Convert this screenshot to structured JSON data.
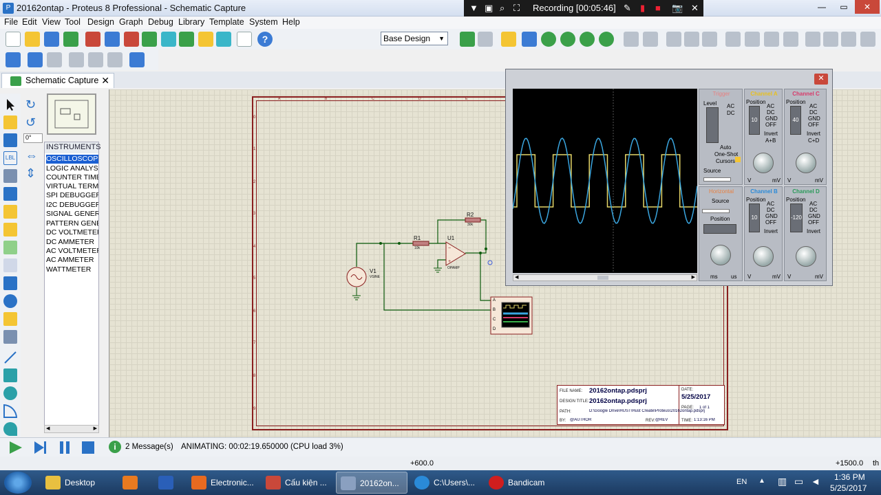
{
  "window": {
    "title": "20162ontap - Proteus 8 Professional - Schematic Capture"
  },
  "recording": {
    "label": "Recording [00:05:46]"
  },
  "menu": [
    "File",
    "Edit",
    "View",
    "Tool",
    "Design",
    "Graph",
    "Debug",
    "Library",
    "Template",
    "System",
    "Help"
  ],
  "toolbar": {
    "design_select": "Base Design"
  },
  "tab": {
    "label": "Schematic Capture"
  },
  "left": {
    "angle": "0°"
  },
  "instruments": {
    "header": "INSTRUMENTS",
    "items": [
      "OSCILLOSCOPE",
      "LOGIC ANALYSER",
      "COUNTER TIMER",
      "VIRTUAL TERMINAL",
      "SPI DEBUGGER",
      "I2C DEBUGGER",
      "SIGNAL GENERATOR",
      "PATTERN GENERATOR",
      "DC VOLTMETER",
      "DC AMMETER",
      "AC VOLTMETER",
      "AC AMMETER",
      "WATTMETER"
    ],
    "selected_index": 0
  },
  "schematic": {
    "r1": "R1",
    "r1_val": "10k",
    "r2": "R2",
    "r2_val": "30k",
    "u1": "U1",
    "u1_type": "OPAMP",
    "v1": "V1",
    "v1_type": "VSINE",
    "scope_pins": [
      "A",
      "B",
      "C",
      "D"
    ],
    "col_labels": [
      "A",
      "B",
      "C",
      "D",
      "E",
      "F",
      "G",
      "H",
      "I",
      "J"
    ],
    "row_labels": [
      "0",
      "1",
      "2",
      "3",
      "4",
      "5",
      "6",
      "7",
      "8",
      "9"
    ]
  },
  "titleblock": {
    "file_name_label": "FILE NAME:",
    "file_name": "20162ontap.pdsprj",
    "design_title_label": "DESIGN TITLE:",
    "design_title": "20162ontap.pdsprj",
    "path_label": "PATH:",
    "path": "D:\\Google Drive\\HUST\\Hust Create\\Proteus\\20162ontap.pdsprj",
    "by_label": "BY:",
    "by": "@AUTHOR",
    "rev_label": "REV:",
    "rev": "@REV",
    "date_label": "DATE:",
    "date": "5/25/2017",
    "page_label": "PAGE:",
    "page": "1 of 1",
    "time_label": "TIME:",
    "time": "1:13:16 PM"
  },
  "oscilloscope": {
    "trigger": "Trigger",
    "channel_a": "Channel A",
    "channel_b": "Channel B",
    "channel_c": "Channel C",
    "channel_d": "Channel D",
    "horizontal": "Horizontal",
    "level": "Level",
    "position": "Position",
    "source": "Source",
    "cursors": "Cursors",
    "auto": "Auto",
    "one_shot": "One-Shot",
    "ac": "AC",
    "dc": "DC",
    "gnd": "GND",
    "off": "OFF",
    "invert": "Invert",
    "a_plus_b": "A+B",
    "c_plus_d": "C+D",
    "pos_a": "10",
    "pos_b": "10",
    "pos_c": "40",
    "pos_d": "-120",
    "unit_v": "V",
    "unit_mv": "mV",
    "unit_ms": "ms",
    "unit_us": "us",
    "colors": {
      "trace_a": "#e6d86a",
      "trace_b": "#3aa6e0",
      "channel_a": "#e8c020",
      "channel_b": "#2a8ad8",
      "channel_c": "#d83a6a",
      "channel_d": "#2a9a5a"
    }
  },
  "status": {
    "messages": "2 Message(s)",
    "animating": "ANIMATING: 00:02:19.650000 (CPU load 3%)"
  },
  "coords": {
    "x": "+600.0",
    "y": "+1500.0",
    "unit": "th"
  },
  "taskbar": {
    "items": [
      {
        "label": "Desktop",
        "color": "#e8c040"
      },
      {
        "label": "",
        "color": "#e87a20"
      },
      {
        "label": "",
        "color": "#2a5fb8"
      },
      {
        "label": "Electronic...",
        "color": "#e86a20"
      },
      {
        "label": "Cấu kiện ...",
        "color": "#c9483a"
      },
      {
        "label": "20162on...",
        "color": "#8aa0c0"
      },
      {
        "label": "C:\\Users\\...",
        "color": "#2a8ad8"
      },
      {
        "label": "Bandicam",
        "color": "#d01e1e"
      }
    ],
    "lang": "EN",
    "time": "1:36 PM",
    "date": "5/25/2017"
  }
}
